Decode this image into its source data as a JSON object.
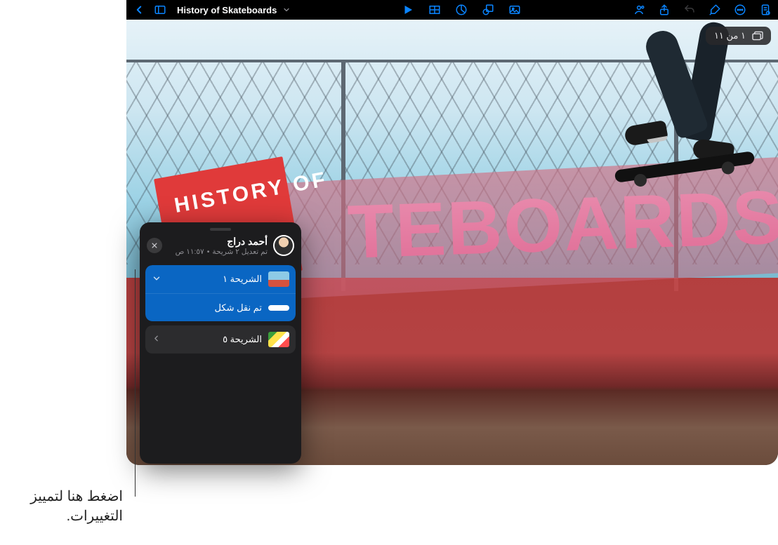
{
  "toolbar": {
    "document_title": "History of Skateboards"
  },
  "slide_indicator": {
    "text": "١ من ١١"
  },
  "slide": {
    "card_text": "HISTORY OF",
    "big_text": "TEBOARDS"
  },
  "panel": {
    "author": "أحمد دراج",
    "meta_edits": "تم تعديل ٢ شريحة",
    "meta_time": "١١:٥٧ ص",
    "rows": {
      "slide1": "الشريحة ١",
      "moved_shape": "تم نقل شكل",
      "slide5": "الشريحة ٥"
    }
  },
  "callout": {
    "line1": "اضغط هنا لتمييز",
    "line2": "التغييرات."
  }
}
